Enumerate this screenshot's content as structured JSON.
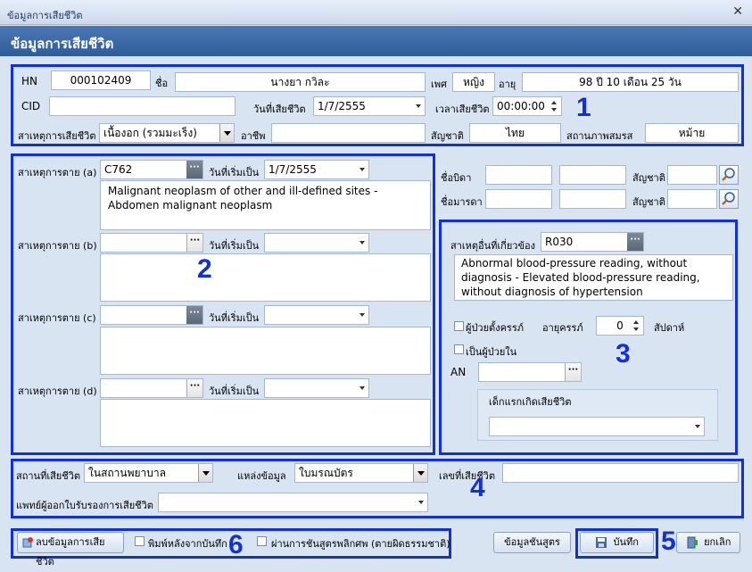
{
  "window": {
    "title": "ข้อมูลการเสียชีวิต",
    "close_icon": "✕"
  },
  "header": {
    "title": "ข้อมูลการเสียชีวิต"
  },
  "patient": {
    "hn_label": "HN",
    "hn": "000102409",
    "name_label": "ชื่อ",
    "name": "นางยา กวิละ",
    "sex_label": "เพศ",
    "sex": "หญิง",
    "age_label": "อายุ",
    "age": "98 ปี 10 เดือน 25 วัน",
    "cid_label": "CID",
    "cid": "",
    "death_date_label": "วันที่เสียชีวิต",
    "death_date": "1/7/2555",
    "death_time_label": "เวลาเสียชีวิต",
    "death_time": "00:00:00",
    "cause_label": "สาเหตุการเสียชีวิต",
    "cause": "เนื้องอก (รวมมะเร็ง)",
    "occupation_label": "อาชีพ",
    "occupation": "",
    "nationality_label": "สัญชาติ",
    "nationality": "ไทย",
    "marital_label": "สถานภาพสมรส",
    "marital": "หม้าย"
  },
  "causes": [
    {
      "label": "สาเหตุการตาย (a)",
      "code": "C762",
      "start_label": "วันที่เริ่มเป็น",
      "start": "1/7/2555",
      "desc": "Malignant neoplasm of other and ill-defined sites - Abdomen malignant neoplasm"
    },
    {
      "label": "สาเหตุการตาย (b)",
      "code": "",
      "start_label": "วันที่เริ่มเป็น",
      "start": "",
      "desc": ""
    },
    {
      "label": "สาเหตุการตาย (c)",
      "code": "",
      "start_label": "วันที่เริ่มเป็น",
      "start": "",
      "desc": ""
    },
    {
      "label": "สาเหตุการตาย (d)",
      "code": "",
      "start_label": "วันที่เริ่มเป็น",
      "start": "",
      "desc": ""
    }
  ],
  "parents": {
    "father_label": "ชื่อบิดา",
    "mother_label": "ชื่อมารดา",
    "nationality_label": "สัญชาติ"
  },
  "other": {
    "label": "สาเหตุอื่นที่เกี่ยวข้อง",
    "code": "R030",
    "desc": "Abnormal blood-pressure reading, without diagnosis - Elevated blood-pressure reading, without diagnosis of hypertension",
    "pregnant_label": "ผู้ป่วยตั้งครรภ์",
    "gest_label": "อายุครรภ์",
    "gest_value": "0",
    "week_label": "สัปดาห์",
    "inpatient_label": "เป็นผู้ป่วยใน",
    "an_label": "AN",
    "an": "",
    "infant_group_label": "เด็กแรกเกิดเสียชีวิต",
    "infant_value": ""
  },
  "place": {
    "place_label": "สถานที่เสียชีวิต",
    "place": "ในสถานพยาบาล",
    "source_label": "แหล่งข้อมูล",
    "source": "ใบมรณบัตร",
    "cert_no_label": "เลขที่เสียชีวิต",
    "cert_no": "",
    "doctor_label": "แพทย์ผู้ออกใบรับรองการเสียชีวิต",
    "doctor": ""
  },
  "footer": {
    "delete_label": "ลบข้อมูลการเสียชีวิต",
    "print_label": "พิมพ์หลังจากบันทึก",
    "autopsy_label": "ผ่านการชันสูตรพลิกศพ (ตายผิดธรรมชาติ)",
    "autopsy_info_label": "ข้อมูลชันสูตร",
    "save_label": "บันทึก",
    "cancel_label": "ยกเลิก"
  },
  "annotations": [
    "1",
    "2",
    "3",
    "4",
    "5",
    "6"
  ]
}
